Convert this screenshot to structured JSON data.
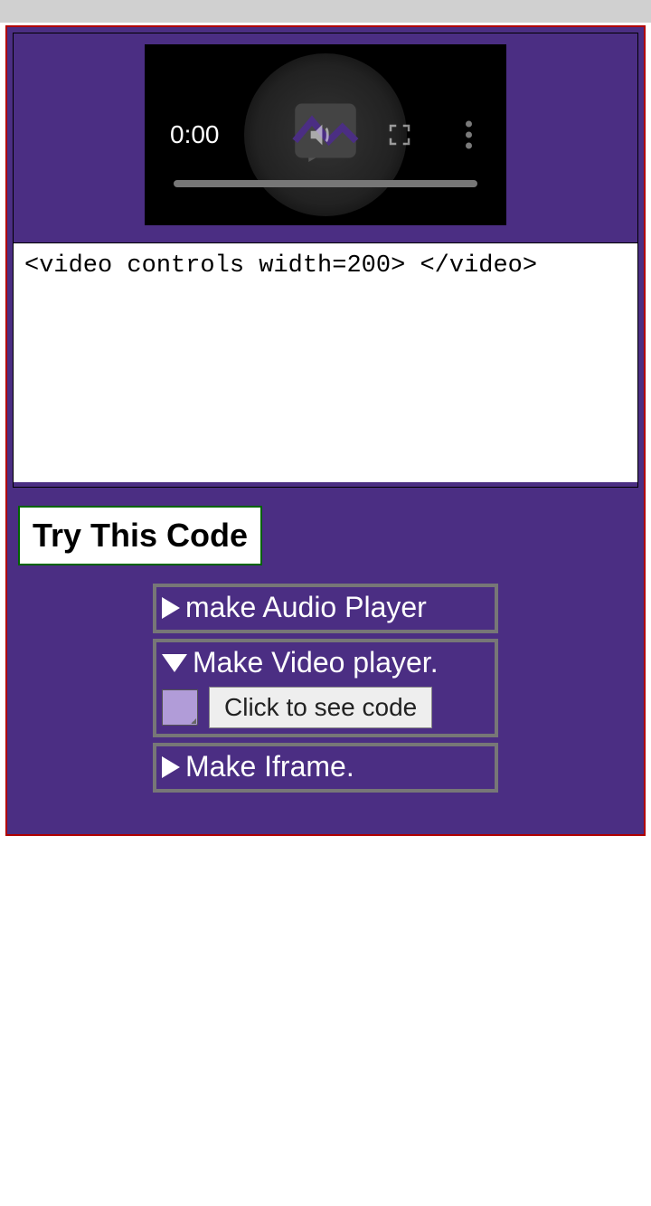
{
  "video": {
    "time_display": "0:00"
  },
  "editor": {
    "code": "<video controls width=200> </video>"
  },
  "buttons": {
    "try_code": "Try This Code",
    "see_code": "Click to see code"
  },
  "accordion": [
    {
      "label": "make Audio Player",
      "expanded": false
    },
    {
      "label": "Make Video player.",
      "expanded": true
    },
    {
      "label": "Make Iframe.",
      "expanded": false
    }
  ]
}
